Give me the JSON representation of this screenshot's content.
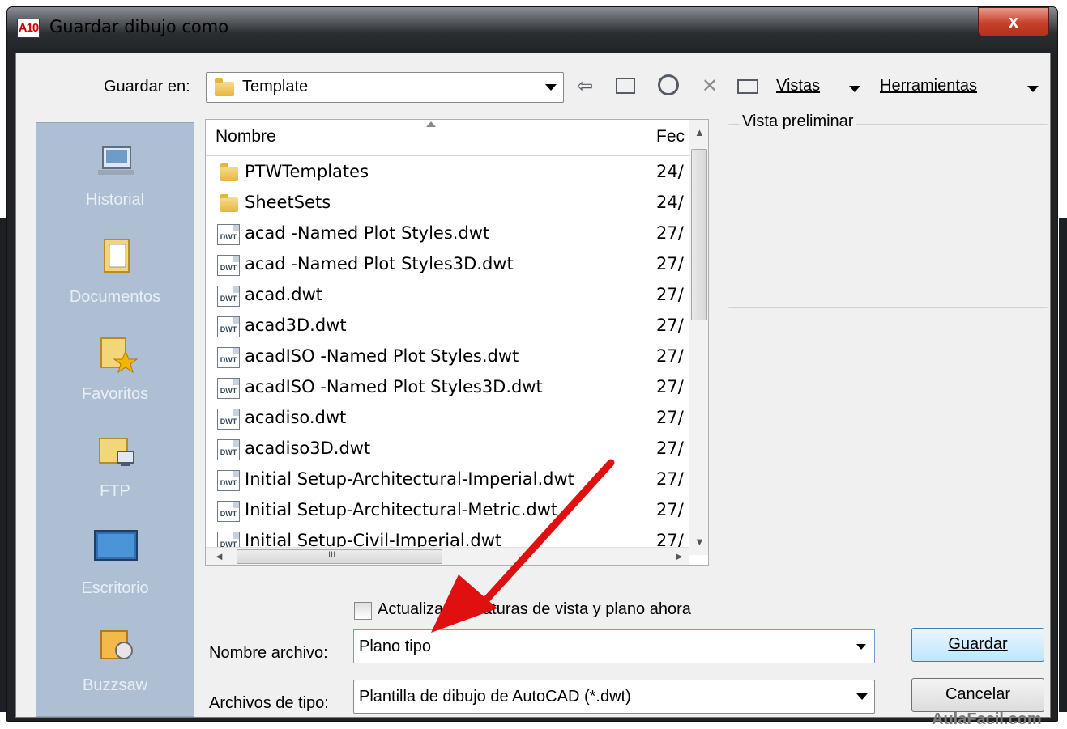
{
  "window": {
    "title": "Guardar dibujo como",
    "app_icon_text": "A10",
    "close_symbol": "x"
  },
  "toolbar": {
    "save_in_label": "Guardar en:",
    "save_in_value": "Template",
    "views_label": "Vistas",
    "tools_label": "Herramientas",
    "back_icon": "⇦",
    "up_icon": "▣",
    "search_icon": "🔍",
    "delete_icon": "✕",
    "new_folder_icon": "▭"
  },
  "places": [
    {
      "label": "Historial",
      "icon": "history-icon"
    },
    {
      "label": "Documentos",
      "icon": "documents-icon"
    },
    {
      "label": "Favoritos",
      "icon": "favorites-icon"
    },
    {
      "label": "FTP",
      "icon": "ftp-icon"
    },
    {
      "label": "Escritorio",
      "icon": "desktop-icon"
    },
    {
      "label": "Buzzsaw",
      "icon": "buzzsaw-icon"
    }
  ],
  "file_list": {
    "col_name": "Nombre",
    "col_date": "Fec",
    "rows": [
      {
        "name": "PTWTemplates",
        "date": "24/",
        "type": "folder"
      },
      {
        "name": "SheetSets",
        "date": "24/",
        "type": "folder"
      },
      {
        "name": "acad -Named Plot Styles.dwt",
        "date": "27/",
        "type": "dwt"
      },
      {
        "name": "acad -Named Plot Styles3D.dwt",
        "date": "27/",
        "type": "dwt"
      },
      {
        "name": "acad.dwt",
        "date": "27/",
        "type": "dwt"
      },
      {
        "name": "acad3D.dwt",
        "date": "27/",
        "type": "dwt"
      },
      {
        "name": "acadISO -Named Plot Styles.dwt",
        "date": "27/",
        "type": "dwt"
      },
      {
        "name": "acadISO -Named Plot Styles3D.dwt",
        "date": "27/",
        "type": "dwt"
      },
      {
        "name": "acadiso.dwt",
        "date": "27/",
        "type": "dwt"
      },
      {
        "name": "acadiso3D.dwt",
        "date": "27/",
        "type": "dwt"
      },
      {
        "name": "Initial Setup-Architectural-Imperial.dwt",
        "date": "27/",
        "type": "dwt"
      },
      {
        "name": "Initial Setup-Architectural-Metric.dwt",
        "date": "27/",
        "type": "dwt"
      },
      {
        "name": "Initial Setup-Civil-Imperial.dwt",
        "date": "27/",
        "type": "dwt"
      }
    ],
    "dwt_icon_text": "DWT",
    "hscroll_grip": "III"
  },
  "preview": {
    "label": "Vista preliminar"
  },
  "update_thumbnails": {
    "label": "Actualizar miniaturas de vista y plano ahora",
    "checked": false
  },
  "filename": {
    "label": "Nombre archivo:",
    "value": "Plano tipo"
  },
  "filetype": {
    "label": "Archivos de tipo:",
    "value": "Plantilla de dibujo de AutoCAD (*.dwt)"
  },
  "buttons": {
    "save": "Guardar",
    "cancel": "Cancelar"
  },
  "watermark": "AulaFacil.com",
  "colors": {
    "annotation_arrow": "#e01010",
    "places_bg": "#aebfd3",
    "primary_button": "#bee6fd"
  }
}
